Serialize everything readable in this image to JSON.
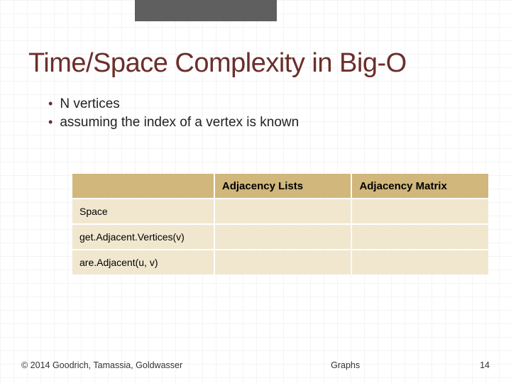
{
  "slide": {
    "title": "Time/Space Complexity in Big-O",
    "bullets": [
      "N vertices",
      "assuming the index of a vertex is known"
    ]
  },
  "table": {
    "headers": [
      "",
      "Adjacency Lists",
      "Adjacency Matrix"
    ],
    "rows": [
      {
        "label": "Space",
        "c1": "",
        "c2": ""
      },
      {
        "label": "get.Adjacent.Vertices(v)",
        "c1": "",
        "c2": ""
      },
      {
        "label": "are.Adjacent(u, v)",
        "c1": "",
        "c2": ""
      }
    ]
  },
  "footer": {
    "copyright": "© 2014 Goodrich, Tamassia, Goldwasser",
    "center": "Graphs",
    "page": "14"
  }
}
